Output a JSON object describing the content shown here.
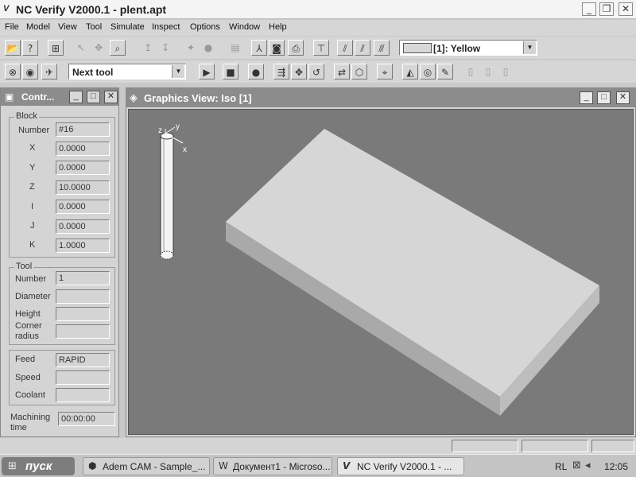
{
  "window": {
    "title": "NC Verify  V2000.1  - plent.apt",
    "logo": "V"
  },
  "window_controls": {
    "minimize": "_",
    "restore": "❐",
    "close": "✕"
  },
  "menu": [
    "File",
    "Model",
    "View",
    "Tool",
    "Simulate",
    "Inspect",
    "Options",
    "Window",
    "Help"
  ],
  "toolbar1": {
    "color_select": "[1]: Yellow",
    "swatch_color": "#d8d8d8"
  },
  "toolbar2": {
    "tool_select": "Next tool"
  },
  "control_panel": {
    "title": "Contr...",
    "block": {
      "legend": "Block",
      "fields": [
        {
          "label": "Number",
          "value": "#16"
        },
        {
          "label": "X",
          "value": "0.0000"
        },
        {
          "label": "Y",
          "value": "0.0000"
        },
        {
          "label": "Z",
          "value": "10.0000"
        },
        {
          "label": "I",
          "value": "0.0000"
        },
        {
          "label": "J",
          "value": "0.0000"
        },
        {
          "label": "K",
          "value": "1.0000"
        }
      ]
    },
    "tool": {
      "legend": "Tool",
      "number_label": "Number",
      "number_value": "1",
      "diameter_label": "Diameter",
      "diameter_value": "",
      "height_label": "Height",
      "height_value": "",
      "corner_label_1": "Corner",
      "corner_label_2": "radius",
      "corner_value": ""
    },
    "feed": {
      "feed_label": "Feed",
      "feed_value": "RAPID",
      "speed_label": "Speed",
      "speed_value": "",
      "coolant_label": "Coolant",
      "coolant_value": ""
    },
    "machining_label_1": "Machining",
    "machining_label_2": "time",
    "machining_value": "00:00:00"
  },
  "graphics_view": {
    "title": "Graphics View: Iso [1]",
    "axes": {
      "z": "z",
      "y": "y",
      "x": "x"
    }
  },
  "taskbar": {
    "start": "пуск",
    "tasks": [
      {
        "title": "Adem CAM - Sample_...",
        "icon": "⬢"
      },
      {
        "title": "Документ1 - Microso...",
        "icon": "W"
      },
      {
        "title": "NC Verify  V2000.1  - ...",
        "icon": "V"
      }
    ],
    "lang": "RL",
    "clock": "12:05"
  }
}
